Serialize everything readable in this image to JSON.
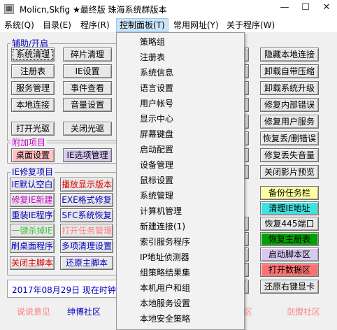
{
  "window": {
    "title": "Molicn,Skfig ★最终版 珠海系统群版本",
    "icon_glyph": "▦"
  },
  "menu": {
    "items": [
      "系统(Q)",
      "目录(E)",
      "程序(R)",
      "控制面板(T)",
      "常用网址(Y)",
      "关于程序(W)"
    ],
    "active_index": 3
  },
  "groups": {
    "auxiliary": {
      "label": "辅助/开启"
    },
    "additional": {
      "label": "附加项目"
    },
    "ie_repair": {
      "label": "IE修复项目"
    }
  },
  "buttons": {
    "aux": [
      "系统清理",
      "碎片清理",
      "注册表",
      "IE设置",
      "服务管理",
      "事件查看",
      "本地连接",
      "音量设置",
      "打开光驱",
      "关闭光驱"
    ],
    "additional": [
      "桌面设置",
      "IE选项管理"
    ],
    "ie": [
      "IE默认空白",
      "播放显示版本",
      "修复IE新建",
      "EXE格式修复",
      "重装IE程序",
      "SFC系统恢复",
      "一键杀掉IE",
      "打开任务管理",
      "刷桌面程序",
      "多项清理设置",
      "关闭主脚本",
      "还原主脚本"
    ],
    "right": [
      "隐藏本地连接",
      "卸载自带压缩",
      "卸载系统升级",
      "修复内部错误",
      "修复用户服务",
      "恢复丢/删错误",
      "修复丢失音量",
      "关闭影片预览",
      "备份任务栏",
      "清理IE地址",
      "恢复445端口",
      "恢复主册表",
      "启动脚本区",
      "打开数据区",
      "还原右键显卡"
    ]
  },
  "status": {
    "date_text": "2017年08月29日 现在时钟18"
  },
  "footer": {
    "links": [
      "说说意见",
      "绅博社区",
      "交流社区",
      "剑盟社区"
    ]
  },
  "dropdown": {
    "items": [
      "策略组",
      "注册表",
      "系统信息",
      "语言设置",
      "用户帐号",
      "显示中心",
      "屏幕键盘",
      "启动配置",
      "设备管理",
      "鼠标设置",
      "系统管理",
      "计算机管理",
      "新建连接(1)",
      "索引服务程序",
      "IP地址侦测器",
      "组策略结果集",
      "本机用户和组",
      "本地服务设置",
      "本地安全策略"
    ]
  },
  "colors": {
    "accent_blue": "#0000c0",
    "magenta": "#c000c0",
    "red": "#e00000",
    "green_bg": "#00a000",
    "pink_bg": "#ffc0c0",
    "lavender_bg": "#d8c8f0",
    "cyan_bg": "#40e0e0",
    "yellow_bg": "#ffffa0",
    "coral_bg": "#ff7070"
  },
  "icons": {
    "minimize": "minimize-icon",
    "maximize": "maximize-icon",
    "close": "close-icon"
  }
}
